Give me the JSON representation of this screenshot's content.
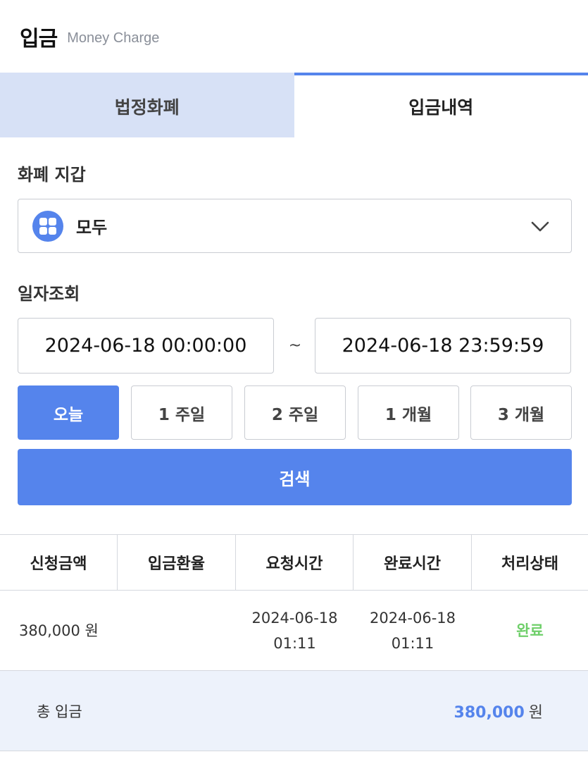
{
  "header": {
    "title": "입금",
    "subtitle": "Money Charge"
  },
  "tabs": [
    {
      "label": "법정화폐",
      "active": false
    },
    {
      "label": "입금내역",
      "active": true
    }
  ],
  "wallet": {
    "label": "화폐 지갑",
    "selected": "모두",
    "icon": "grid-icon",
    "chevron": "chevron-down-icon"
  },
  "date_query": {
    "label": "일자조회",
    "start": "2024-06-18 00:00:00",
    "separator": "~",
    "end": "2024-06-18 23:59:59"
  },
  "periods": [
    {
      "label": "오늘",
      "selected": true
    },
    {
      "label": "1 주일",
      "selected": false
    },
    {
      "label": "2 주일",
      "selected": false
    },
    {
      "label": "1 개월",
      "selected": false
    },
    {
      "label": "3 개월",
      "selected": false
    }
  ],
  "search_label": "검색",
  "table": {
    "headers": [
      "신청금액",
      "입금환율",
      "요청시간",
      "완료시간",
      "처리상태"
    ],
    "rows": [
      {
        "amount": "380,000 원",
        "rate": "",
        "request_date": "2024-06-18",
        "request_time": "01:11",
        "complete_date": "2024-06-18",
        "complete_time": "01:11",
        "status": "완료"
      }
    ]
  },
  "total": {
    "label": "총 입금",
    "amount": "380,000",
    "unit": "원"
  },
  "colors": {
    "accent": "#5584ec",
    "tab_inactive_bg": "#d7e1f6",
    "status_complete": "#6fcf6a",
    "total_bg": "#edf2fb"
  }
}
